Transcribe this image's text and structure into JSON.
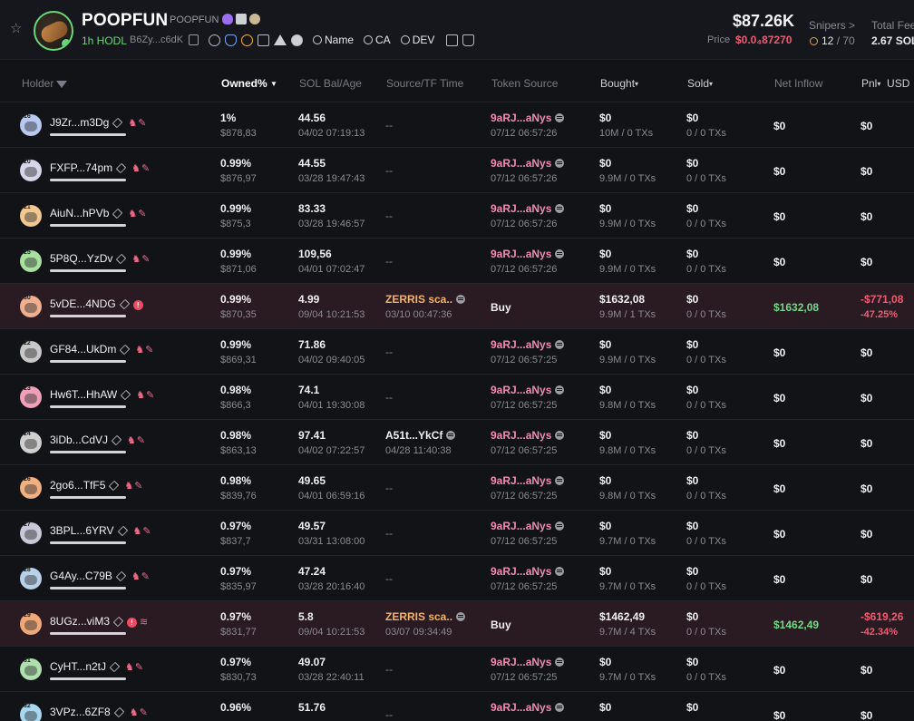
{
  "token": {
    "name": "POOPFUN",
    "ticker": "POOPFUN",
    "hodl": "1h HODL",
    "address": "B6Zy...c6dK",
    "price_big": "$87.26K",
    "price_label": "Price",
    "price_value": "$0.0₄87270",
    "snipers_label": "Snipers >",
    "snipers_value": "12",
    "snipers_total": "/ 70",
    "fees_label": "Total Fee",
    "fees_value": "2.67 SOL"
  },
  "search_chips": [
    "Name",
    "CA",
    "DEV"
  ],
  "columns": {
    "holder": "Holder",
    "owned": "Owned%",
    "solbal": "SOL Bal/Age",
    "source": "Source/TF Time",
    "token_source": "Token Source",
    "bought": "Bought",
    "sold": "Sold",
    "net_inflow": "Net Inflow",
    "pnl": "Pnl",
    "usd": "USD"
  },
  "colors": {
    "accent_green": "#6ad67a",
    "pink": "#ef8bb4",
    "red": "#ee5b73",
    "orange": "#f2b36b"
  },
  "rows": [
    {
      "name": "J9Zr...m3Dg",
      "owned": "1%",
      "usd": "$878,83",
      "sol": "44.56",
      "age": "04/02 07:19:13",
      "source": "--",
      "token1": "9aRJ...aNys",
      "token2": "07/12 06:57:26",
      "bought1": "$0",
      "bought2": "10M / 0 TXs",
      "sold1": "$0",
      "sold2": "0 / 0 TXs",
      "inflow": "$0",
      "pnl": "$0",
      "avatar": "#b8c8f0",
      "num": "16"
    },
    {
      "name": "FXFP...74pm",
      "owned": "0.99%",
      "usd": "$876,97",
      "sol": "44.55",
      "age": "03/28 19:47:43",
      "source": "--",
      "token1": "9aRJ...aNys",
      "token2": "07/12 06:57:26",
      "bought1": "$0",
      "bought2": "9.9M / 0 TXs",
      "sold1": "$0",
      "sold2": "0 / 0 TXs",
      "inflow": "$0",
      "pnl": "$0",
      "avatar": "#d6d6ea",
      "num": "20"
    },
    {
      "name": "AiuN...hPVb",
      "owned": "0.99%",
      "usd": "$875,3",
      "sol": "83.33",
      "age": "03/28 19:46:57",
      "source": "--",
      "token1": "9aRJ...aNys",
      "token2": "07/12 06:57:26",
      "bought1": "$0",
      "bought2": "9.9M / 0 TXs",
      "sold1": "$0",
      "sold2": "0 / 0 TXs",
      "inflow": "$0",
      "pnl": "$0",
      "avatar": "#f0c890",
      "num": "21"
    },
    {
      "name": "5P8Q...YzDv",
      "owned": "0.99%",
      "usd": "$871,06",
      "sol": "109,56",
      "age": "04/01 07:02:47",
      "source": "--",
      "token1": "9aRJ...aNys",
      "token2": "07/12 06:57:26",
      "bought1": "$0",
      "bought2": "9.9M / 0 TXs",
      "sold1": "$0",
      "sold2": "0 / 0 TXs",
      "inflow": "$0",
      "pnl": "$0",
      "avatar": "#a8e0a0",
      "num": "25"
    },
    {
      "name": "5vDE...4NDG",
      "owned": "0.99%",
      "usd": "$870,35",
      "sol": "4.99",
      "age": "09/04 10:21:53",
      "source": "ZERRIS sca..",
      "source_time": "03/10 00:47:36",
      "buy": "Buy",
      "bought1": "$1632,08",
      "bought2": "9.9M / 1 TXs",
      "sold1": "$0",
      "sold2": "0 / 0 TXs",
      "inflow": "$1632,08",
      "pnl": "-$771,08",
      "pnl_pct": "-47.25%",
      "avatar": "#f0b090",
      "num": "30",
      "highlight": true
    },
    {
      "name": "GF84...UkDm",
      "owned": "0.99%",
      "usd": "$869,31",
      "sol": "71.86",
      "age": "04/02 09:40:05",
      "source": "--",
      "token1": "9aRJ...aNys",
      "token2": "07/12 06:57:25",
      "bought1": "$0",
      "bought2": "9.9M / 0 TXs",
      "sold1": "$0",
      "sold2": "0 / 0 TXs",
      "inflow": "$0",
      "pnl": "$0",
      "avatar": "#c8c8c8",
      "num": "22"
    },
    {
      "name": "Hw6T...HhAW",
      "owned": "0.98%",
      "usd": "$866,3",
      "sol": "74.1",
      "age": "04/01 19:30:08",
      "source": "--",
      "token1": "9aRJ...aNys",
      "token2": "07/12 06:57:25",
      "bought1": "$0",
      "bought2": "9.8M / 0 TXs",
      "sold1": "$0",
      "sold2": "0 / 0 TXs",
      "inflow": "$0",
      "pnl": "$0",
      "avatar": "#f0a0b8",
      "num": "23"
    },
    {
      "name": "3iDb...CdVJ",
      "owned": "0.98%",
      "usd": "$863,13",
      "sol": "97.41",
      "age": "04/02 07:22:57",
      "source": "A51t...YkCf",
      "source_time": "04/28 11:40:38",
      "token1": "9aRJ...aNys",
      "token2": "07/12 06:57:25",
      "bought1": "$0",
      "bought2": "9.8M / 0 TXs",
      "sold1": "$0",
      "sold2": "0 / 0 TXs",
      "inflow": "$0",
      "pnl": "$0",
      "avatar": "#d0d0d0",
      "num": "24"
    },
    {
      "name": "2go6...TfF5",
      "owned": "0.98%",
      "usd": "$839,76",
      "sol": "49.65",
      "age": "04/01 06:59:16",
      "source": "--",
      "token1": "9aRJ...aNys",
      "token2": "07/12 06:57:25",
      "bought1": "$0",
      "bought2": "9.8M / 0 TXs",
      "sold1": "$0",
      "sold2": "0 / 0 TXs",
      "inflow": "$0",
      "pnl": "$0",
      "avatar": "#f0b080",
      "num": "26"
    },
    {
      "name": "3BPL...6YRV",
      "owned": "0.97%",
      "usd": "$837,7",
      "sol": "49.57",
      "age": "03/31 13:08:00",
      "source": "--",
      "token1": "9aRJ...aNys",
      "token2": "07/12 06:57:25",
      "bought1": "$0",
      "bought2": "9.7M / 0 TXs",
      "sold1": "$0",
      "sold2": "0 / 0 TXs",
      "inflow": "$0",
      "pnl": "$0",
      "avatar": "#c8c8d8",
      "num": "27"
    },
    {
      "name": "G4Ay...C79B",
      "owned": "0.97%",
      "usd": "$835,97",
      "sol": "47.24",
      "age": "03/28 20:16:40",
      "source": "--",
      "token1": "9aRJ...aNys",
      "token2": "07/12 06:57:25",
      "bought1": "$0",
      "bought2": "9.7M / 0 TXs",
      "sold1": "$0",
      "sold2": "0 / 0 TXs",
      "inflow": "$0",
      "pnl": "$0",
      "avatar": "#b8d0e8",
      "num": "28"
    },
    {
      "name": "8UGz...viM3",
      "owned": "0.97%",
      "usd": "$831,77",
      "sol": "5.8",
      "age": "09/04 10:21:53",
      "source": "ZERRIS sca..",
      "source_time": "03/07 09:34:49",
      "buy": "Buy",
      "bought1": "$1462,49",
      "bought2": "9.7M / 4 TXs",
      "sold1": "$0",
      "sold2": "0 / 0 TXs",
      "inflow": "$1462,49",
      "pnl": "-$619,26",
      "pnl_pct": "-42.34%",
      "avatar": "#f0a878",
      "num": "29",
      "highlight": true
    },
    {
      "name": "CyHT...n2tJ",
      "owned": "0.97%",
      "usd": "$830,73",
      "sol": "49.07",
      "age": "03/28 22:40:11",
      "source": "--",
      "token1": "9aRJ...aNys",
      "token2": "07/12 06:57:25",
      "bought1": "$0",
      "bought2": "9.7M / 0 TXs",
      "sold1": "$0",
      "sold2": "0 / 0 TXs",
      "inflow": "$0",
      "pnl": "$0",
      "avatar": "#b0e0b0",
      "num": "31"
    },
    {
      "name": "3VPz...6ZF8",
      "owned": "0.96%",
      "usd": "",
      "sol": "51.76",
      "age": "",
      "source": "--",
      "token1": "9aRJ...aNys",
      "token2": "",
      "bought1": "$0",
      "bought2": "",
      "sold1": "$0",
      "sold2": "",
      "inflow": "$0",
      "pnl": "$0",
      "avatar": "#a8d8f0",
      "num": "32"
    }
  ]
}
